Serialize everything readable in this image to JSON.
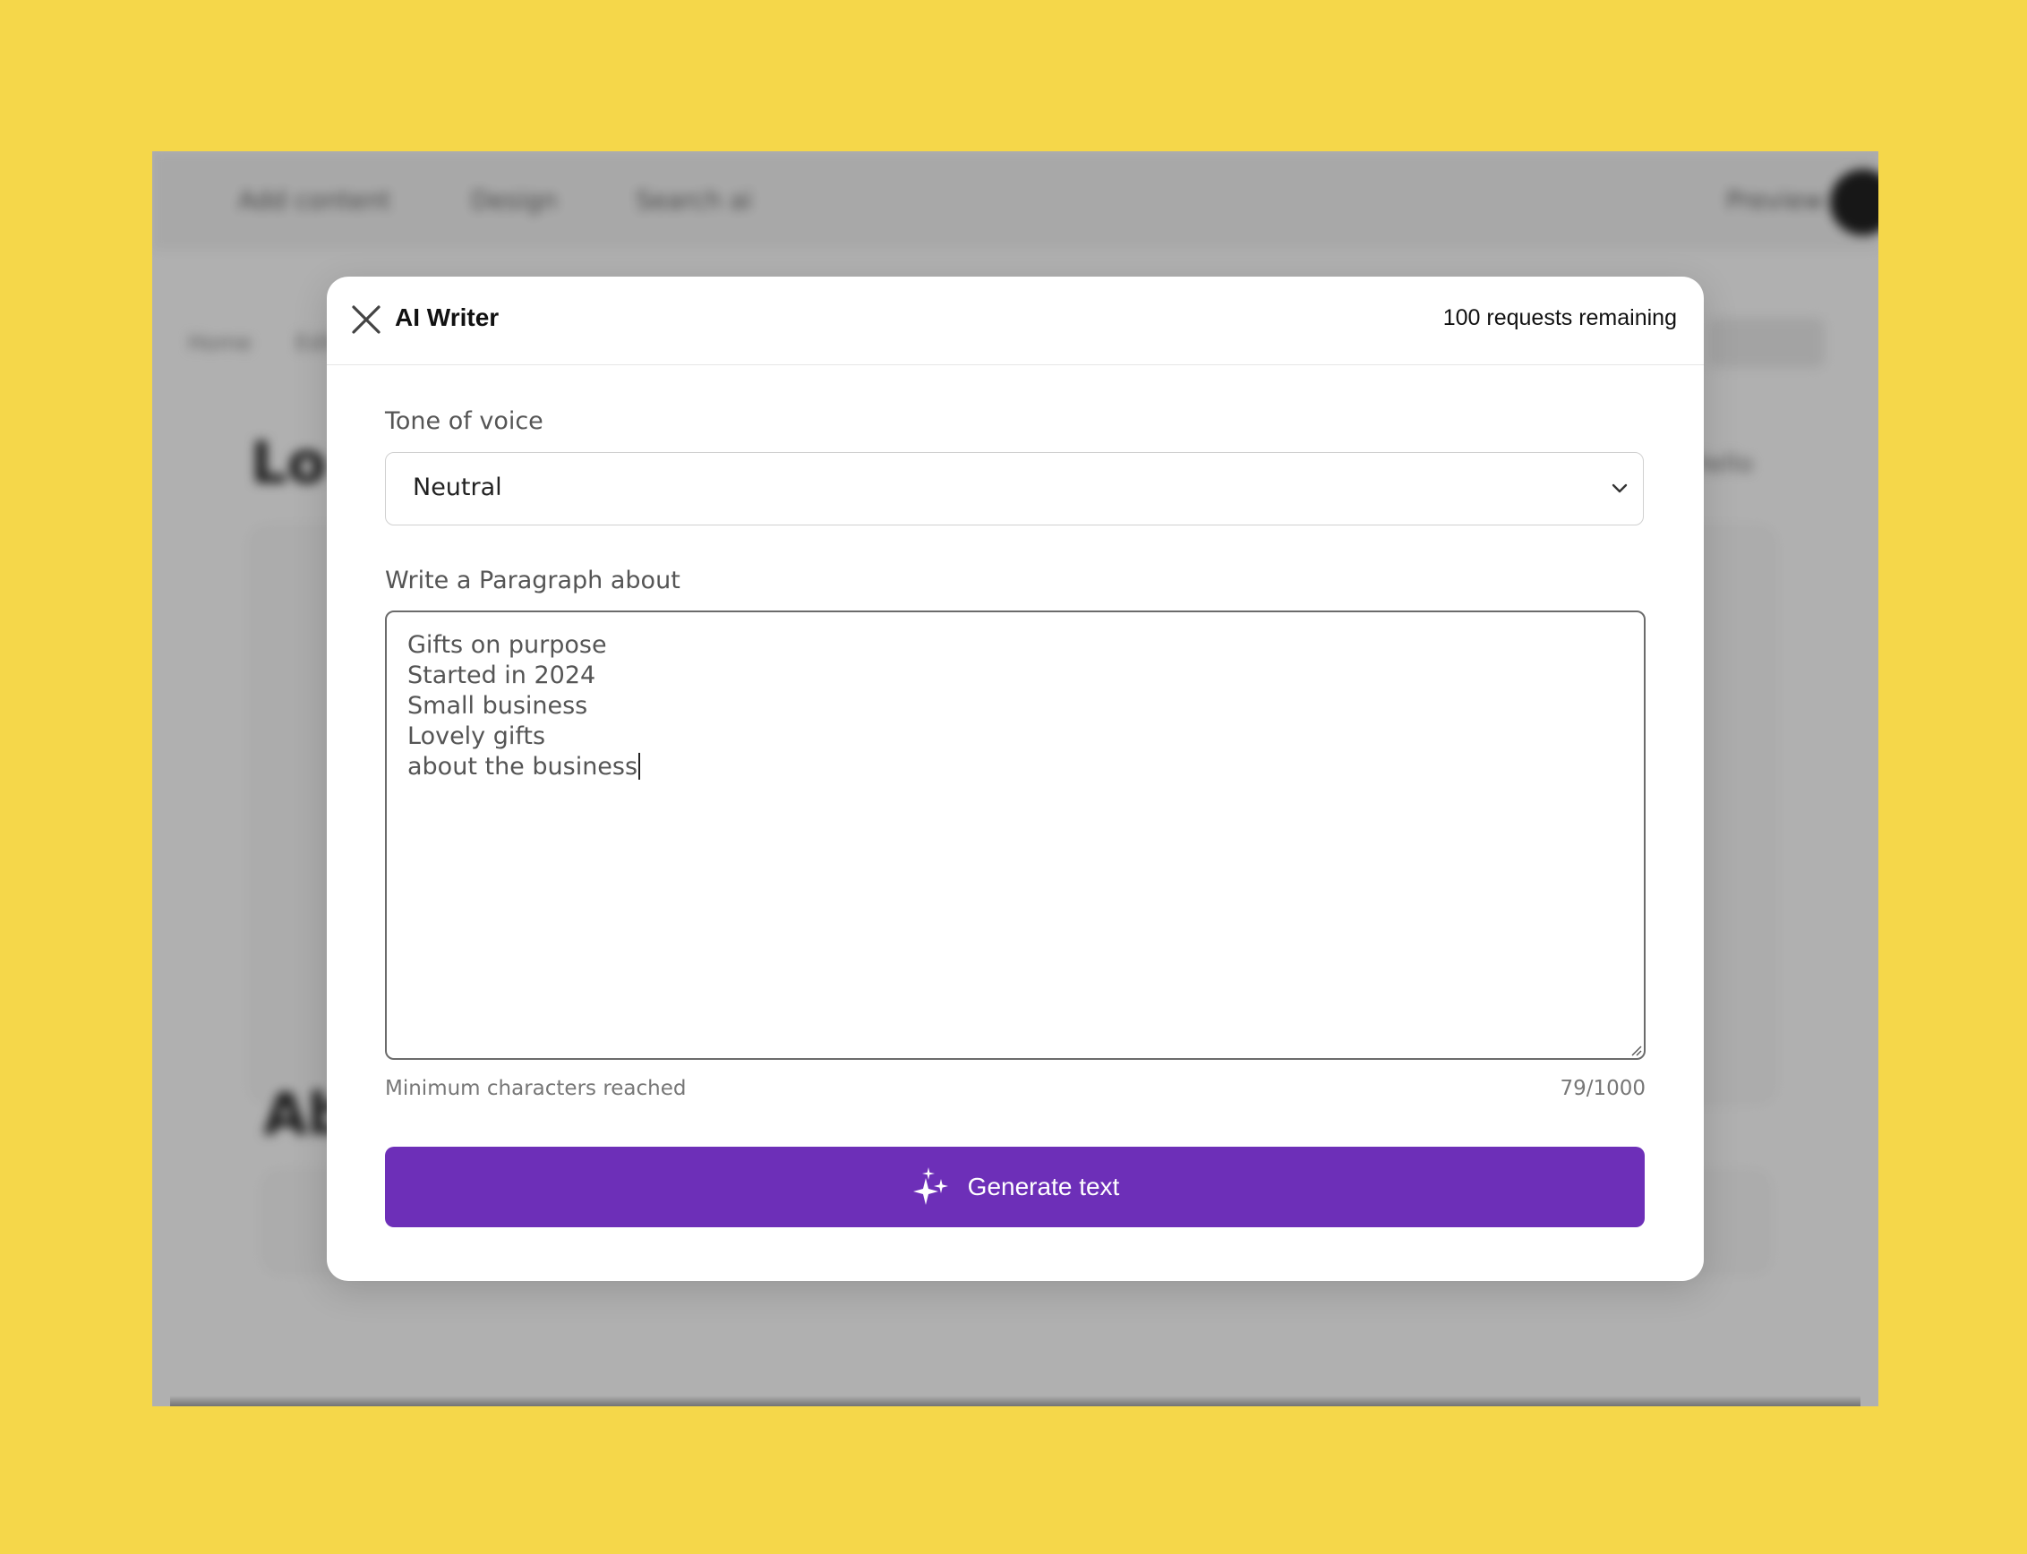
{
  "background_app": {
    "nav": [
      "Add content",
      "Design",
      "Search ai",
      "Preview"
    ],
    "subbar": [
      "Home",
      "Edit"
    ],
    "headings": [
      "Lo",
      "Ab"
    ],
    "side_link": "Hello"
  },
  "modal": {
    "title": "AI Writer",
    "close_icon": "close-icon",
    "requests_remaining": "100 requests remaining",
    "tone": {
      "label": "Tone of voice",
      "selected": "Neutral",
      "icon": "chevron-down-icon"
    },
    "paragraph": {
      "label": "Write a Paragraph about",
      "lines": [
        "Gifts on purpose",
        "Started in 2024",
        "Small business",
        "Lovely gifts",
        "about the business"
      ],
      "helper": "Minimum characters reached",
      "count": "79/1000"
    },
    "generate": {
      "label": "Generate text",
      "icon": "sparkle-icon",
      "color": "#6d2fb8"
    }
  },
  "colors": {
    "page_background": "#f5d74a",
    "modal_background": "#ffffff",
    "accent": "#6d2fb8"
  }
}
